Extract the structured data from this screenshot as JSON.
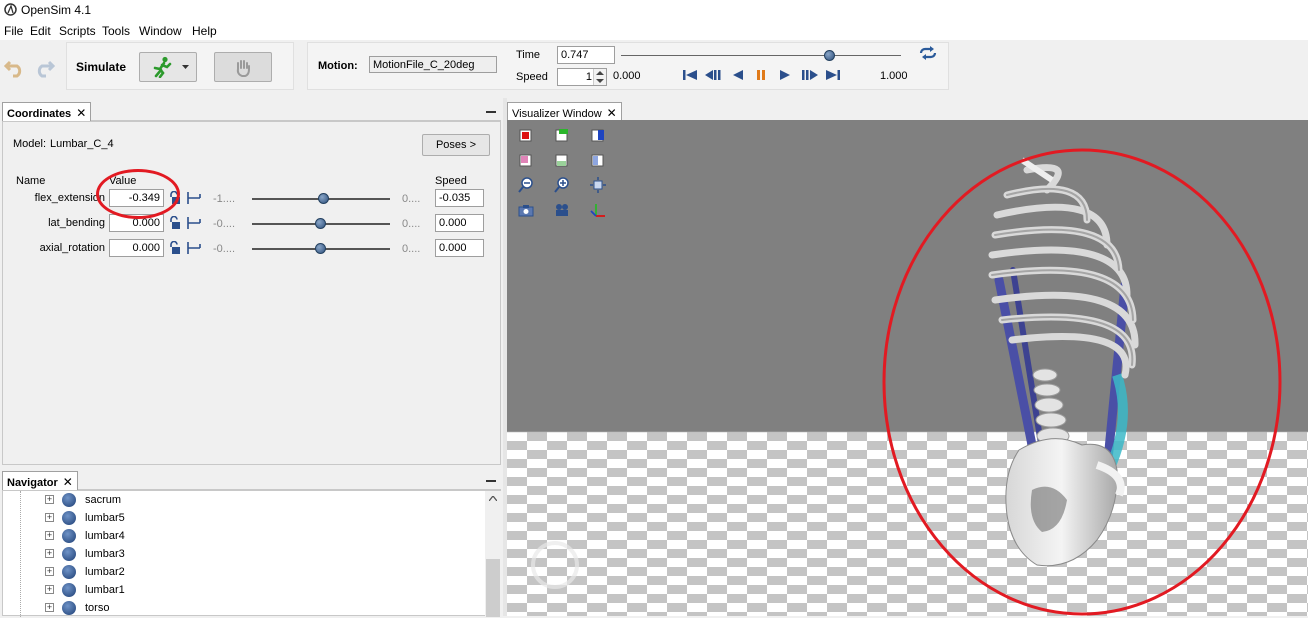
{
  "app": {
    "title": "OpenSim 4.1"
  },
  "menu": [
    "File",
    "Edit",
    "Scripts",
    "Tools",
    "Window",
    "Help"
  ],
  "toolbar": {
    "simulate_label": "Simulate",
    "motion_label": "Motion:",
    "motion_value": "MotionFile_C_20deg",
    "time_label": "Time",
    "time_value": "0.747",
    "speed_label": "Speed",
    "speed_value": "1",
    "range_start": "0.000",
    "range_end": "1.000",
    "time_fraction": 0.747
  },
  "coordinates": {
    "tab_label": "Coordinates",
    "model_label": "Model:",
    "model_name": "Lumbar_C_4",
    "poses_button": "Poses >",
    "col_name": "Name",
    "col_value": "Value",
    "col_speed": "Speed",
    "rows": [
      {
        "name": "flex_extension",
        "value": "-0.349",
        "min": "-1....",
        "max": "0....",
        "speed": "-0.035",
        "fraction": 0.52
      },
      {
        "name": "lat_bending",
        "value": "0.000",
        "min": "-0....",
        "max": "0....",
        "speed": "0.000",
        "fraction": 0.5
      },
      {
        "name": "axial_rotation",
        "value": "0.000",
        "min": "-0....",
        "max": "0....",
        "speed": "0.000",
        "fraction": 0.5
      }
    ]
  },
  "navigator": {
    "tab_label": "Navigator",
    "items": [
      "sacrum",
      "lumbar5",
      "lumbar4",
      "lumbar3",
      "lumbar2",
      "lumbar1",
      "torso"
    ]
  },
  "visualizer": {
    "tab_label": "Visualizer Window",
    "colors": {
      "sky": "#808080",
      "floor_light": "#ffffff",
      "floor_dark": "#c4c4c4",
      "annotation": "#e21a22"
    }
  }
}
